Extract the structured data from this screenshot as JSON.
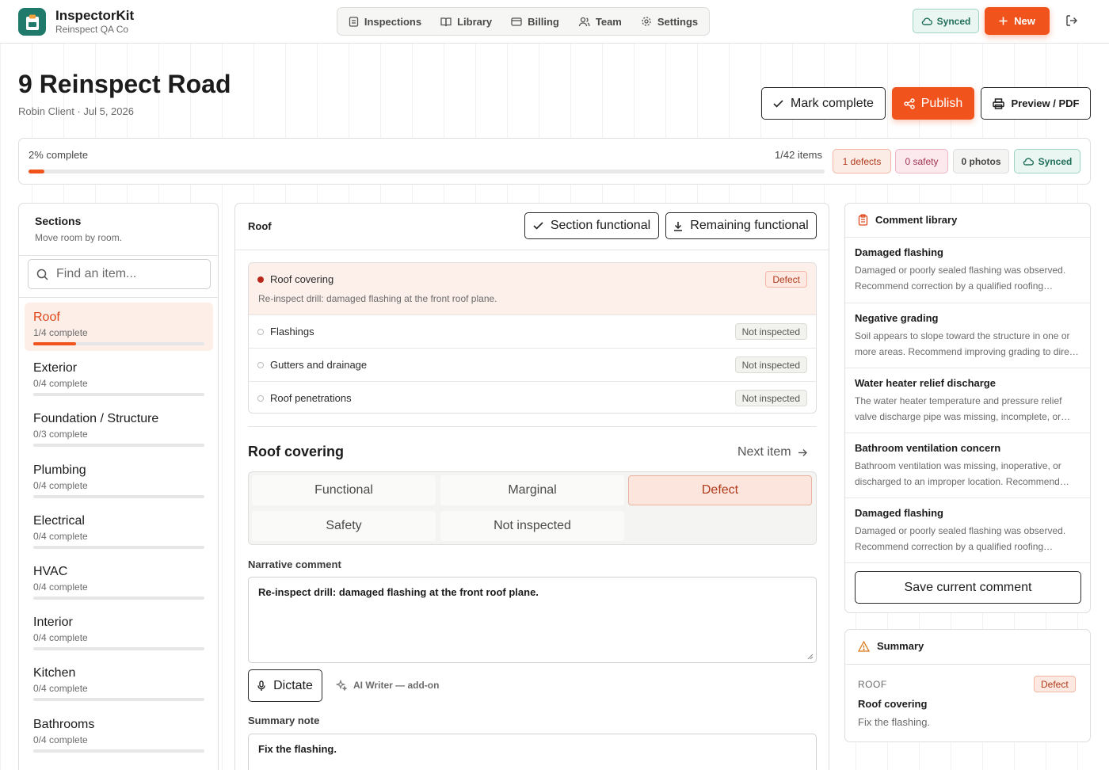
{
  "app": {
    "name": "InspectorKit",
    "org": "Reinspect QA Co",
    "accent": "#f0531c"
  },
  "nav": {
    "items": [
      {
        "label": "Inspections",
        "icon": "clipboard-icon"
      },
      {
        "label": "Library",
        "icon": "book-icon"
      },
      {
        "label": "Billing",
        "icon": "card-icon"
      },
      {
        "label": "Team",
        "icon": "users-icon"
      },
      {
        "label": "Settings",
        "icon": "gear-icon"
      }
    ],
    "synced_label": "Synced",
    "new_label": "New"
  },
  "page": {
    "title": "9 Reinspect Road",
    "subtitle": "Robin Client · Jul 5, 2026",
    "actions": {
      "mark_complete": "Mark complete",
      "publish": "Publish",
      "preview": "Preview / PDF"
    }
  },
  "progress": {
    "label": "2% complete",
    "percent": 2,
    "items": "1/42 items",
    "chips": {
      "defects": "1 defects",
      "safety": "0 safety",
      "photos": "0 photos",
      "synced": "Synced"
    }
  },
  "sections": {
    "title": "Sections",
    "subtitle": "Move room by room.",
    "search_placeholder": "Find an item...",
    "list": [
      {
        "name": "Roof",
        "progress": "1/4 complete",
        "fraction": 0.25,
        "active": true
      },
      {
        "name": "Exterior",
        "progress": "0/4 complete",
        "fraction": 0
      },
      {
        "name": "Foundation / Structure",
        "progress": "0/3 complete",
        "fraction": 0
      },
      {
        "name": "Plumbing",
        "progress": "0/4 complete",
        "fraction": 0
      },
      {
        "name": "Electrical",
        "progress": "0/4 complete",
        "fraction": 0
      },
      {
        "name": "HVAC",
        "progress": "0/4 complete",
        "fraction": 0
      },
      {
        "name": "Interior",
        "progress": "0/4 complete",
        "fraction": 0
      },
      {
        "name": "Kitchen",
        "progress": "0/4 complete",
        "fraction": 0
      },
      {
        "name": "Bathrooms",
        "progress": "0/4 complete",
        "fraction": 0
      }
    ]
  },
  "section_panel": {
    "heading": "Roof",
    "section_functional": "Section functional",
    "remaining_functional": "Remaining functional",
    "items": [
      {
        "name": "Roof covering",
        "status": "Defect",
        "note": "Re-inspect drill: damaged flashing at the front roof plane."
      },
      {
        "name": "Flashings",
        "status": "Not inspected"
      },
      {
        "name": "Gutters and drainage",
        "status": "Not inspected"
      },
      {
        "name": "Roof penetrations",
        "status": "Not inspected"
      }
    ]
  },
  "detail": {
    "title": "Roof covering",
    "next_item": "Next item",
    "ratings": [
      "Functional",
      "Marginal",
      "Defect",
      "Safety",
      "Not inspected"
    ],
    "selected_rating": "Defect",
    "narrative_label": "Narrative comment",
    "narrative_value": "Re-inspect drill: damaged flashing at the front roof plane.",
    "dictate": "Dictate",
    "ai_writer": "AI Writer — add-on",
    "summary_label": "Summary note",
    "summary_value": "Fix the flashing."
  },
  "library": {
    "title": "Comment library",
    "entries": [
      {
        "title": "Damaged flashing",
        "text": "Damaged or poorly sealed flashing was observed. Recommend correction by a qualified roofing contractor."
      },
      {
        "title": "Negative grading",
        "text": "Soil appears to slope toward the structure in one or more areas. Recommend improving grading to direct water away."
      },
      {
        "title": "Water heater relief discharge",
        "text": "The water heater temperature and pressure relief valve discharge pipe was missing, incomplete, or improperly routed."
      },
      {
        "title": "Bathroom ventilation concern",
        "text": "Bathroom ventilation was missing, inoperative, or discharged to an improper location. Recommend correction."
      },
      {
        "title": "Damaged flashing",
        "text": "Damaged or poorly sealed flashing was observed. Recommend correction by a qualified roofing contractor."
      }
    ],
    "save_label": "Save current comment"
  },
  "summary": {
    "title": "Summary",
    "section": "ROOF",
    "badge": "Defect",
    "item": "Roof covering",
    "note": "Fix the flashing."
  }
}
